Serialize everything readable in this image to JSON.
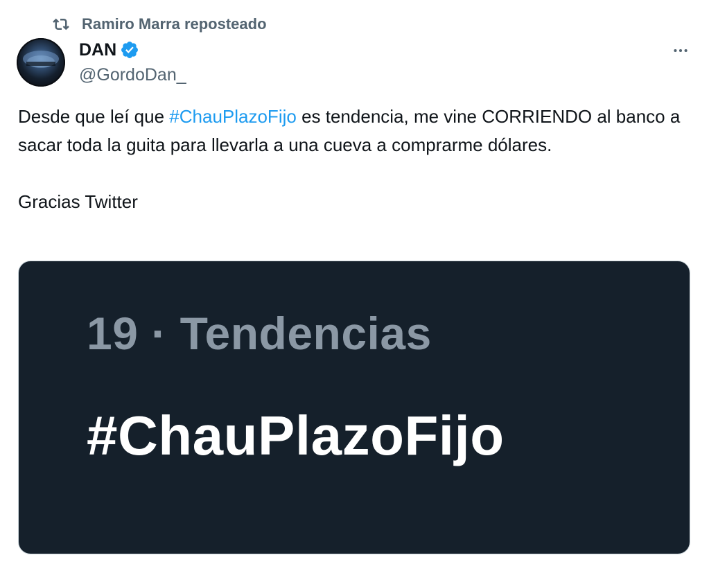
{
  "repost": {
    "text": "Ramiro Marra reposteado",
    "icon": "repost-icon"
  },
  "author": {
    "name": "DAN",
    "handle": "@GordoDan_",
    "verified": true,
    "verified_icon": "verified-badge-icon",
    "avatar_icon": "avatar"
  },
  "more_icon": "more-horizontal-icon",
  "tweet": {
    "text_before": "Desde que leí que ",
    "hashtag": "#ChauPlazoFijo",
    "text_after": " es tendencia, me vine CORRIENDO al banco a sacar toda la guita para llevarla a una cueva a comprarme dólares.",
    "closing": "Gracias Twitter"
  },
  "media": {
    "trend_meta": "19 · Tendencias",
    "trend_name": "#ChauPlazoFijo"
  },
  "colors": {
    "accent": "#1d9bf0",
    "secondary_text": "#536471",
    "media_background": "#15202b",
    "media_meta_text": "#8b98a5"
  }
}
